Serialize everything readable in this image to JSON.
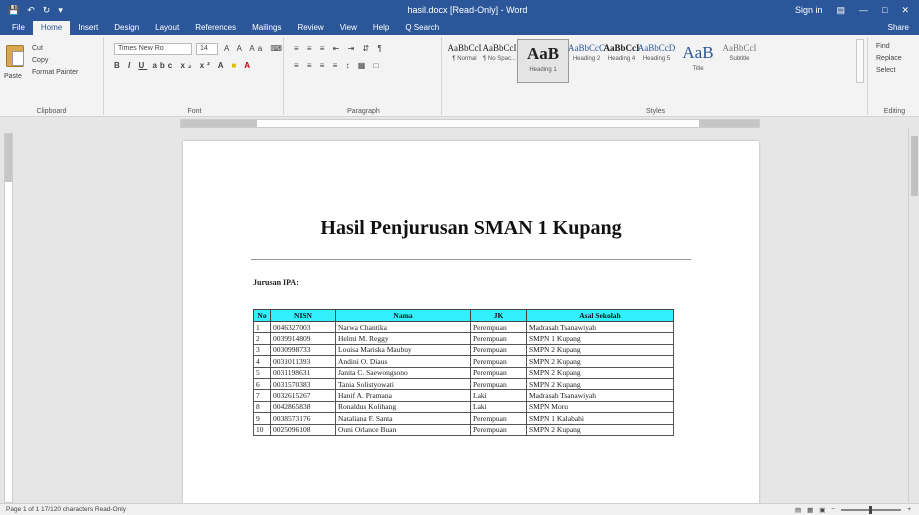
{
  "window": {
    "title": "hasil.docx [Read-Only] - Word",
    "sign_in": "Sign in",
    "qat_icons": [
      "save-icon",
      "undo-icon",
      "redo-icon",
      "customize-icon"
    ]
  },
  "ribbon_tabs": [
    "File",
    "Home",
    "Insert",
    "Design",
    "Layout",
    "References",
    "Mailings",
    "Review",
    "View",
    "Help",
    "Q Search"
  ],
  "active_tab": "Home",
  "share_label": "Share",
  "clipboard": {
    "paste": "Paste",
    "cut": "Cut",
    "copy": "Copy",
    "format_painter": "Format Painter",
    "label": "Clipboard"
  },
  "font": {
    "name": "Times New Ro",
    "size": "14",
    "label": "Font"
  },
  "paragraph": {
    "label": "Paragraph"
  },
  "styles": {
    "label": "Styles",
    "items": [
      {
        "sample": "AaBbCcI",
        "name": "¶ Normal"
      },
      {
        "sample": "AaBbCcI",
        "name": "¶ No Spac..."
      },
      {
        "sample": "AaB",
        "name": "Heading 1"
      },
      {
        "sample": "AaBbCcC",
        "name": "Heading 2"
      },
      {
        "sample": "AaBbCcI",
        "name": "Heading 4"
      },
      {
        "sample": "AaBbCcD",
        "name": "Heading 5"
      },
      {
        "sample": "AaB",
        "name": "Title"
      },
      {
        "sample": "AaBbCcI",
        "name": "Subtitle"
      }
    ]
  },
  "editing": {
    "find": "Find",
    "replace": "Replace",
    "select": "Select",
    "label": "Editing"
  },
  "document": {
    "title": "Hasil Penjurusan SMAN 1 Kupang",
    "subheading": "Jurusan IPA:",
    "table": {
      "headers": [
        "No",
        "NISN",
        "Nama",
        "JK",
        "Asal Sekolah"
      ],
      "rows": [
        [
          "1",
          "0046327003",
          "Narwa Chantika",
          "Perempuan",
          "Madrasah Tsanawiyah"
        ],
        [
          "2",
          "0039914809",
          "Helmi M. Reggy",
          "Perempuan",
          "SMPN 1 Kupang"
        ],
        [
          "3",
          "0030998733",
          "Louisa Mariska Maubuy",
          "Perempuan",
          "SMPN 2 Kupang"
        ],
        [
          "4",
          "0031011393",
          "Andini O. Diaus",
          "Perempuan",
          "SMPN 2 Kupang"
        ],
        [
          "5",
          "0031198631",
          "Janita C. Saewongsono",
          "Perempuan",
          "SMPN 2 Kupang"
        ],
        [
          "6",
          "0031570383",
          "Tania Solistyowati",
          "Perempuan",
          "SMPN 2 Kupang"
        ],
        [
          "7",
          "0032615267",
          "Hanif A. Pramana",
          "Laki",
          "Madrasah Tsanawiyah"
        ],
        [
          "8",
          "0042865838",
          "Ronaldus Kolihang",
          "Laki",
          "SMPN Moru"
        ],
        [
          "9",
          "0038573176",
          "Nataliana F. Santa",
          "Perempuan",
          "SMPN 1 Kalabahi"
        ],
        [
          "10",
          "0025096108",
          "Ouni Orlance Buan",
          "Perempuan",
          "SMPN 2 Kupang"
        ]
      ]
    }
  },
  "status": {
    "text": "Page 1 of 1  17/120 characters  Read-Only"
  }
}
